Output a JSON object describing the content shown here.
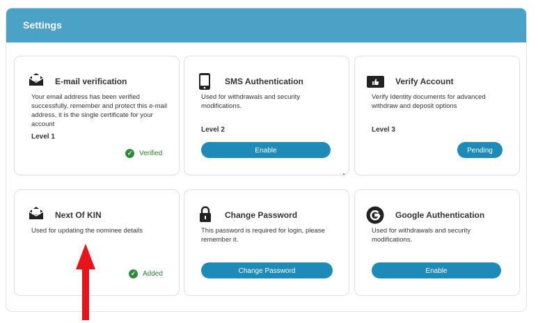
{
  "settings": {
    "title": "Settings",
    "cards": [
      {
        "icon": "envelope-icon",
        "title": "E-mail verification",
        "description": "Your email address has been verified successfully, remember and protect this e-mail address, it is the single certificate for your account",
        "level": "Level 1",
        "status": "Verified"
      },
      {
        "icon": "smartphone-icon",
        "title": "SMS Authentication",
        "description": "Used for withdrawals and security modifications.",
        "level": "Level 2",
        "button": "Enable"
      },
      {
        "icon": "thumbs-up-icon",
        "title": "Verify Account",
        "description": "Verify Identity documents for advanced withdraw and deposit options",
        "level": "Level 3",
        "button": "Pending"
      },
      {
        "icon": "envelope-icon",
        "title": "Next Of KIN",
        "description": "Used for updating the nominee details",
        "status": "Added"
      },
      {
        "icon": "lock-icon",
        "title": "Change Password",
        "description": "This password is required for login, please remember it.",
        "button": "Change Password"
      },
      {
        "icon": "google-icon",
        "title": "Google Authentication",
        "description": "Used for withdrawals and security modifications.",
        "button": "Enable"
      }
    ]
  },
  "colors": {
    "header": "#4aa3c7",
    "button": "#1d8ab8",
    "verified": "#2f8a3a",
    "arrow": "#e8141b"
  }
}
